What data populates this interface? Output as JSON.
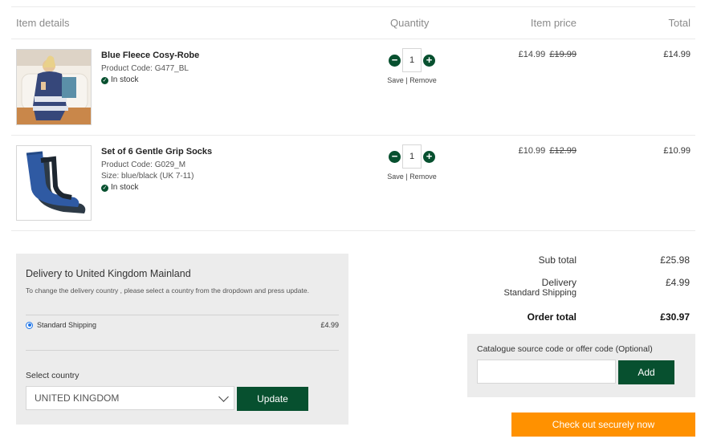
{
  "header": {
    "item_details": "Item details",
    "quantity": "Quantity",
    "item_price": "Item price",
    "total": "Total"
  },
  "items": [
    {
      "name": "Blue Fleece Cosy-Robe",
      "product_code": "Product Code: G477_BL",
      "stock": "In stock",
      "quantity": "1",
      "save": "Save",
      "separator": "|",
      "remove": "Remove",
      "price": "£14.99",
      "old_price": "£19.99",
      "total": "£14.99"
    },
    {
      "name": "Set of 6 Gentle Grip Socks",
      "product_code": "Product Code: G029_M",
      "size": "Size: blue/black (UK 7-11)",
      "stock": "In stock",
      "quantity": "1",
      "save": "Save",
      "separator": "|",
      "remove": "Remove",
      "price": "£10.99",
      "old_price": "£12.99",
      "total": "£10.99"
    }
  ],
  "delivery": {
    "title": "Delivery to United Kingdom Mainland",
    "note": "To change the delivery country , please select a country from the dropdown and press update.",
    "option_label": "Standard Shipping",
    "option_cost": "£4.99",
    "select_label": "Select country",
    "selected_country": "UNITED KINGDOM",
    "update_label": "Update"
  },
  "summary": {
    "subtotal_label": "Sub total",
    "subtotal_value": "£25.98",
    "delivery_label": "Delivery",
    "delivery_method": "Standard Shipping",
    "delivery_value": "£4.99",
    "order_total_label": "Order total",
    "order_total_value": "£30.97"
  },
  "promo": {
    "label": "Catalogue source code or offer code (Optional)",
    "value": "",
    "add_label": "Add"
  },
  "checkout": {
    "label": "Check out securely now"
  },
  "icons": {
    "minus": "minus-circle-icon",
    "plus": "plus-circle-icon",
    "stock": "check-circle-icon",
    "dropdown": "chevron-down-icon"
  },
  "colors": {
    "brand_green": "#07502f",
    "checkout_orange": "#ff9100",
    "panel_grey": "#ececec"
  }
}
